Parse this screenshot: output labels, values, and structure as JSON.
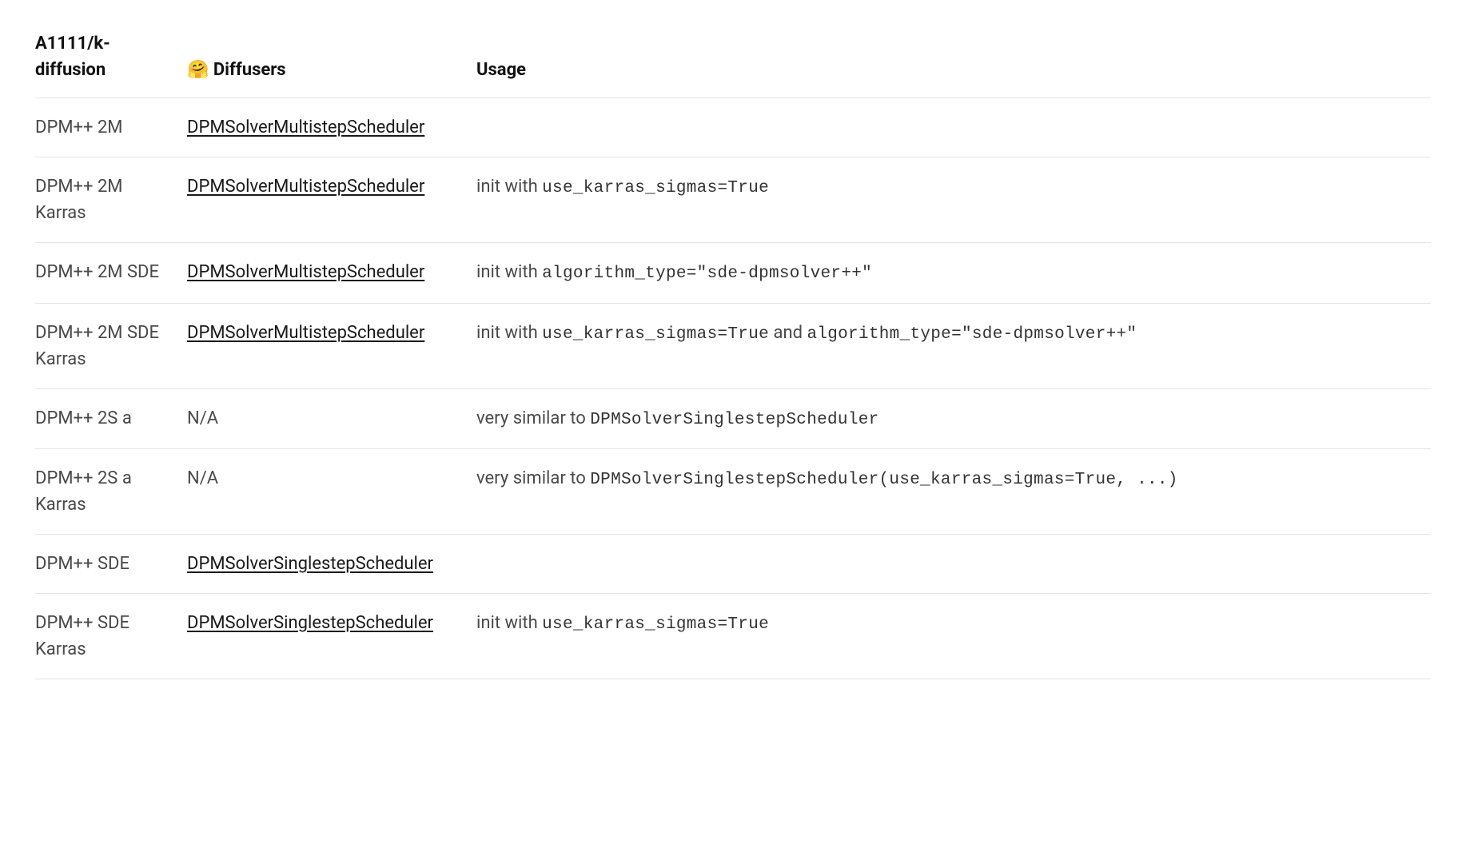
{
  "headers": {
    "col0": "A1111/k-diffusion",
    "col1_emoji": "🤗",
    "col1_text": " Diffusers",
    "col2": "Usage"
  },
  "rows": [
    {
      "a1111": "DPM++ 2M",
      "diffusers": {
        "text": "DPMSolverMultistepScheduler",
        "link": true
      },
      "usage": []
    },
    {
      "a1111": "DPM++ 2M Karras",
      "diffusers": {
        "text": "DPMSolverMultistepScheduler",
        "link": true
      },
      "usage": [
        {
          "t": "text",
          "v": "init with "
        },
        {
          "t": "code",
          "v": "use_karras_sigmas=True"
        }
      ]
    },
    {
      "a1111": "DPM++ 2M SDE",
      "diffusers": {
        "text": "DPMSolverMultistepScheduler",
        "link": true
      },
      "usage": [
        {
          "t": "text",
          "v": "init with "
        },
        {
          "t": "code",
          "v": "algorithm_type=\"sde-dpmsolver++\""
        }
      ]
    },
    {
      "a1111": "DPM++ 2M SDE Karras",
      "diffusers": {
        "text": "DPMSolverMultistepScheduler",
        "link": true
      },
      "usage": [
        {
          "t": "text",
          "v": "init with "
        },
        {
          "t": "code",
          "v": "use_karras_sigmas=True"
        },
        {
          "t": "text",
          "v": " and "
        },
        {
          "t": "code",
          "v": "algorithm_type=\"sde-dpmsolver++\""
        }
      ]
    },
    {
      "a1111": "DPM++ 2S a",
      "diffusers": {
        "text": "N/A",
        "link": false
      },
      "usage": [
        {
          "t": "text",
          "v": "very similar to "
        },
        {
          "t": "code",
          "v": "DPMSolverSinglestepScheduler"
        }
      ]
    },
    {
      "a1111": "DPM++ 2S a Karras",
      "diffusers": {
        "text": "N/A",
        "link": false
      },
      "usage": [
        {
          "t": "text",
          "v": "very similar to "
        },
        {
          "t": "code",
          "v": "DPMSolverSinglestepScheduler(use_karras_sigmas=True, ...)"
        }
      ]
    },
    {
      "a1111": "DPM++ SDE",
      "diffusers": {
        "text": "DPMSolverSinglestepScheduler",
        "link": true
      },
      "usage": []
    },
    {
      "a1111": "DPM++ SDE Karras",
      "diffusers": {
        "text": "DPMSolverSinglestepScheduler",
        "link": true
      },
      "usage": [
        {
          "t": "text",
          "v": "init with "
        },
        {
          "t": "code",
          "v": "use_karras_sigmas=True"
        }
      ]
    }
  ]
}
